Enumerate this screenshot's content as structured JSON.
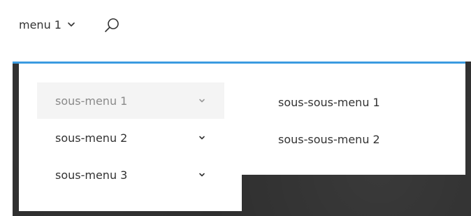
{
  "header": {
    "menu_label": "menu 1"
  },
  "icons": {
    "menu_chevron": "chevron-down-icon",
    "search": "search-icon"
  },
  "submenu": {
    "items": [
      {
        "label": "sous-menu 1",
        "active": true
      },
      {
        "label": "sous-menu 2",
        "active": false
      },
      {
        "label": "sous-menu 3",
        "active": false
      }
    ]
  },
  "subsubmenu": {
    "items": [
      {
        "label": "sous-sous-menu 1"
      },
      {
        "label": "sous-sous-menu 2"
      }
    ]
  },
  "colors": {
    "accent": "#3b9be0",
    "active_item_bg": "#f4f4f4",
    "active_item_text": "#8a8a8a",
    "text": "#333333",
    "backdrop": "#2f2f2f"
  }
}
